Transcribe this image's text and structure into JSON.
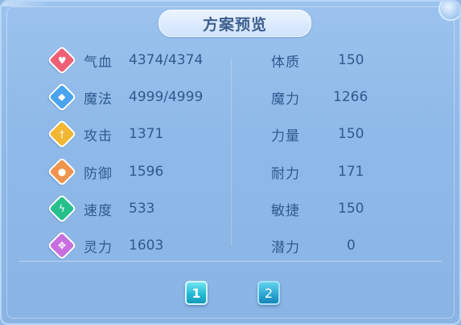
{
  "panel": {
    "title": "方案预览"
  },
  "left_stats": [
    {
      "label": "气血",
      "value": "4374/4374",
      "icon": "heart-icon",
      "color": "#ef5f75"
    },
    {
      "label": "魔法",
      "value": "4999/4999",
      "icon": "mana-icon",
      "color": "#4aa3ef"
    },
    {
      "label": "攻击",
      "value": "1371",
      "icon": "sword-icon",
      "color": "#f2b733"
    },
    {
      "label": "防御",
      "value": "1596",
      "icon": "armor-icon",
      "color": "#f0944d"
    },
    {
      "label": "速度",
      "value": "533",
      "icon": "lightning-icon",
      "color": "#27c08d"
    },
    {
      "label": "灵力",
      "value": "1603",
      "icon": "spirit-icon",
      "color": "#c86fe0"
    }
  ],
  "right_stats": [
    {
      "label": "体质",
      "value": "150"
    },
    {
      "label": "魔力",
      "value": "1266"
    },
    {
      "label": "力量",
      "value": "150"
    },
    {
      "label": "耐力",
      "value": "171"
    },
    {
      "label": "敏捷",
      "value": "150"
    },
    {
      "label": "潜力",
      "value": "0"
    }
  ],
  "pagination": {
    "pages": [
      "1",
      "2"
    ],
    "current": "1"
  }
}
